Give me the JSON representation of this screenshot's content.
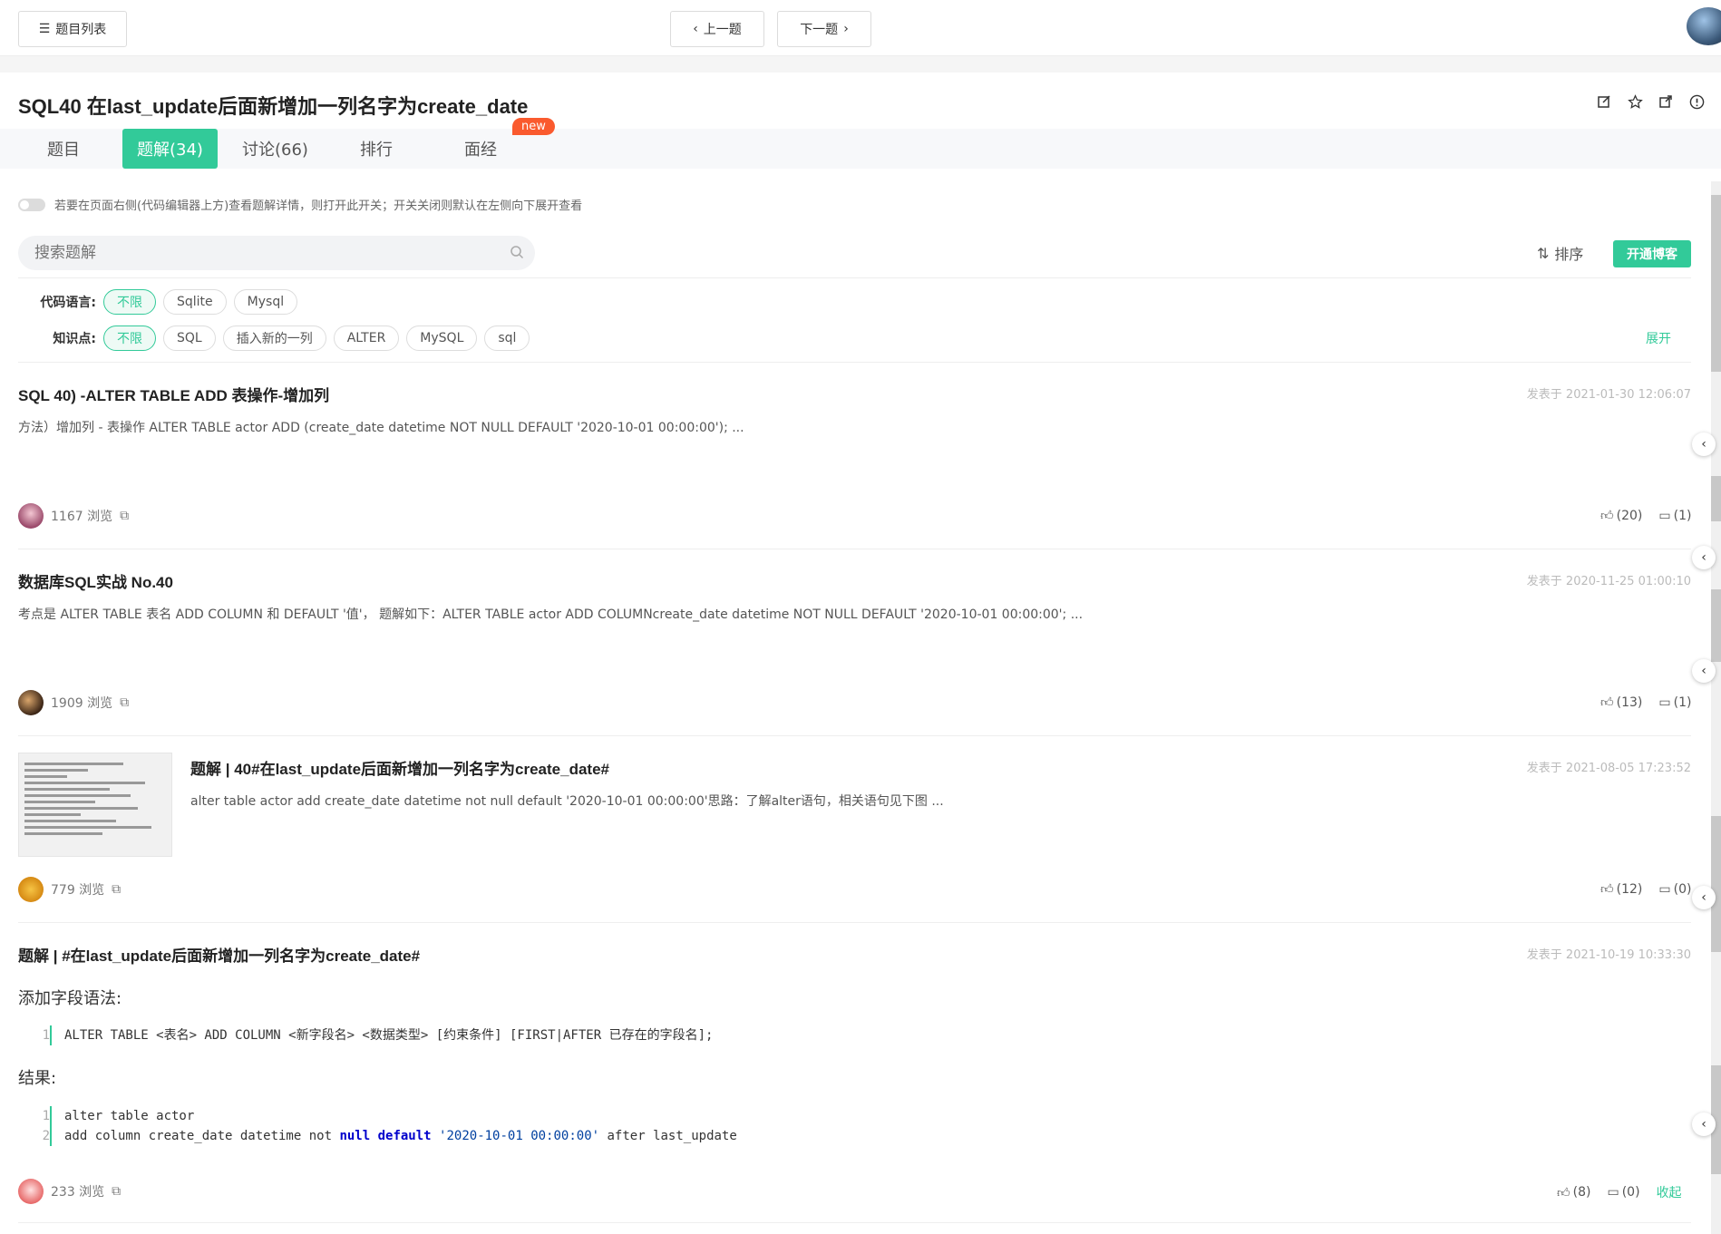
{
  "topbar": {
    "list_label": "题目列表",
    "prev_label": "上一题",
    "next_label": "下一题"
  },
  "problem": {
    "title": "SQL40  在last_update后面新增加一列名字为create_date"
  },
  "tabs": [
    {
      "label": "题目"
    },
    {
      "label": "题解(34)"
    },
    {
      "label": "讨论(66)"
    },
    {
      "label": "排行"
    },
    {
      "label": "面经"
    }
  ],
  "new_badge": "new",
  "toggle_hint": "若要在页面右侧(代码编辑器上方)查看题解详情，则打开此开关；开关关闭则默认在左侧向下展开查看",
  "search": {
    "placeholder": "搜索题解"
  },
  "sort_label": "排序",
  "blog_button": "开通博客",
  "filters": {
    "language_label": "代码语言:",
    "languages": [
      "不限",
      "Sqlite",
      "Mysql"
    ],
    "topic_label": "知识点:",
    "topics": [
      "不限",
      "SQL",
      "插入新的一列",
      "ALTER",
      "MySQL",
      "sql"
    ],
    "expand_label": "展开"
  },
  "posts": [
    {
      "title": "SQL 40) -ALTER TABLE ADD 表操作-增加列",
      "date": "发表于 2021-01-30 12:06:07",
      "excerpt": "方法）增加列 - 表操作 ALTER TABLE actor ADD (create_date datetime NOT NULL DEFAULT '2020-10-01 00:00:00'); ...",
      "views": "1167 浏览",
      "likes": "(20)",
      "comments": "(1)"
    },
    {
      "title": "数据库SQL实战 No.40",
      "date": "发表于 2020-11-25 01:00:10",
      "excerpt": "考点是 ALTER TABLE 表名 ADD COLUMN 和 DEFAULT '值'， 题解如下：ALTER TABLE actor ADD COLUMNcreate_date datetime NOT NULL DEFAULT '2020-10-01 00:00:00'; ...",
      "views": "1909 浏览",
      "likes": "(13)",
      "comments": "(1)"
    },
    {
      "title": "题解 | 40#在last_update后面新增加一列名字为create_date#",
      "date": "发表于 2021-08-05 17:23:52",
      "excerpt": "alter table actor add create_date datetime not null default '2020-10-01 00:00:00'思路：了解alter语句，相关语句见下图 ...",
      "views": "779 浏览",
      "likes": "(12)",
      "comments": "(0)"
    },
    {
      "title": "题解 | #在last_update后面新增加一列名字为create_date#",
      "date": "发表于 2021-10-19 10:33:30",
      "syntax_label": "添加字段语法:",
      "syntax_code": "ALTER TABLE <表名> ADD COLUMN <新字段名> <数据类型> [约束条件] [FIRST|AFTER 已存在的字段名];",
      "result_label": "结果:",
      "code_line1": "alter table actor",
      "code_line2_a": "add column create_date datetime not ",
      "code_line2_null": "null",
      "code_line2_default": "default",
      "code_line2_str": "'2020-10-01 00:00:00'",
      "code_line2_b": " after last_update",
      "views": "233 浏览",
      "likes": "(8)",
      "comments": "(0)",
      "collapse_label": "收起"
    }
  ],
  "colors": {
    "accent": "#32ca99",
    "badge": "#fa5a2e"
  }
}
